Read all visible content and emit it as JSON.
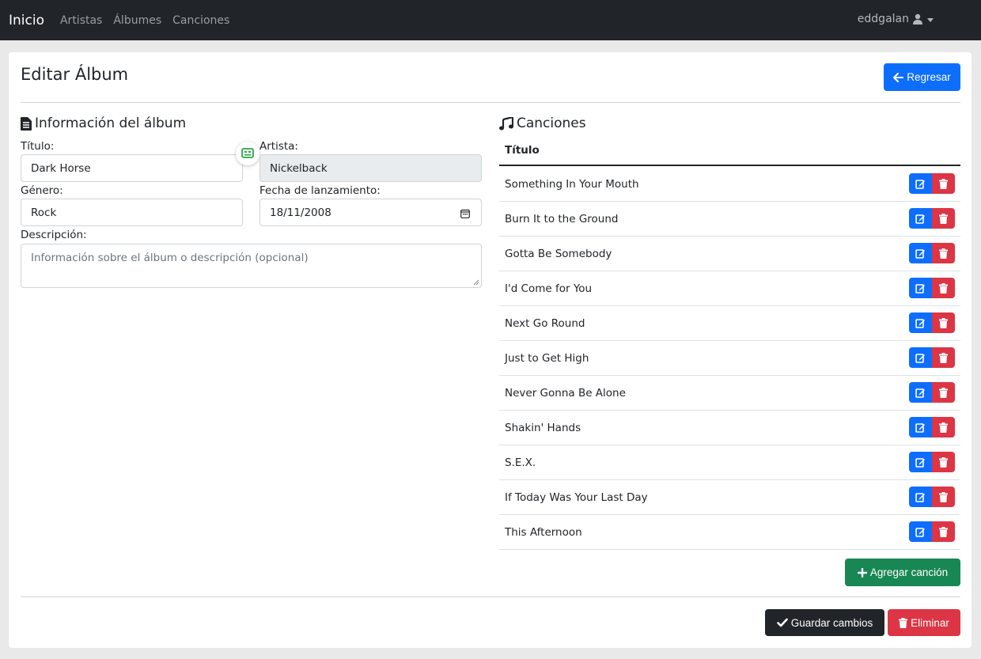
{
  "nav": {
    "brand": "Inicio",
    "links": [
      "Artistas",
      "Álbumes",
      "Canciones"
    ],
    "user": "eddgalan",
    "user_icon": "user-icon"
  },
  "page": {
    "title": "Editar Álbum",
    "back_label": "Regresar",
    "back_icon": "arrow-left-icon"
  },
  "album_info": {
    "heading": "Información del álbum",
    "heading_icon": "file-text-icon",
    "fields": {
      "titulo": {
        "label": "Título:",
        "value": "Dark Horse"
      },
      "artista": {
        "label": "Artista:",
        "value": "Nickelback"
      },
      "genero": {
        "label": "Género:",
        "value": "Rock"
      },
      "fecha": {
        "label": "Fecha de lanzamiento:",
        "value": "18/11/2008"
      },
      "descripcion": {
        "label": "Descripción:",
        "placeholder": "Información sobre el álbum o descripción (opcional)"
      }
    }
  },
  "songs": {
    "heading": "Canciones",
    "heading_icon": "music-icon",
    "column_header": "Título",
    "items": [
      "Something In Your Mouth",
      "Burn It to the Ground",
      "Gotta Be Somebody",
      "I'd Come for You",
      "Next Go Round",
      "Just to Get High",
      "Never Gonna Be Alone",
      "Shakin' Hands",
      "S.E.X.",
      "If Today Was Your Last Day",
      "This Afternoon"
    ],
    "add_label": "Agregar canción"
  },
  "footer": {
    "save_label": "Guardar cambios",
    "delete_label": "Eliminar"
  },
  "colors": {
    "primary": "#0d6efd",
    "danger": "#dc3545",
    "success": "#198754",
    "dark": "#212529"
  }
}
